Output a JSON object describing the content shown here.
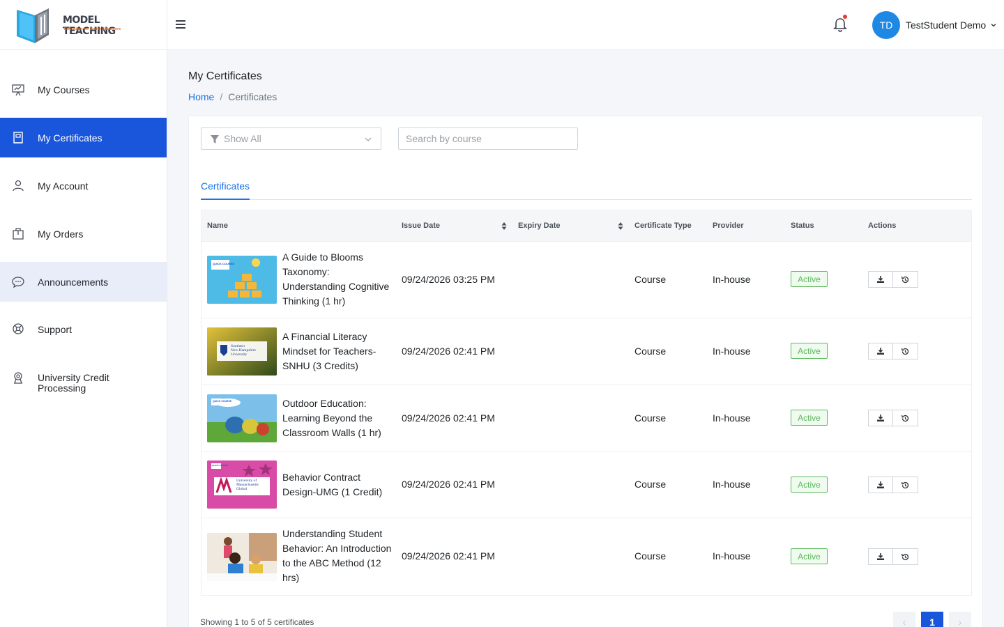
{
  "brand": {
    "name": "MODEL TEACHING",
    "tagline": "Education for Better Educators"
  },
  "user": {
    "initials": "TD",
    "name": "TestStudent Demo"
  },
  "sidebar": {
    "items": [
      {
        "label": "My Courses",
        "icon": "presentation-board-icon"
      },
      {
        "label": "My Certificates",
        "icon": "certificate-book-icon",
        "active": true
      },
      {
        "label": "My Account",
        "icon": "user-icon"
      },
      {
        "label": "My Orders",
        "icon": "order-box-icon"
      },
      {
        "label": "Announcements",
        "icon": "chat-bubble-icon"
      },
      {
        "label": "Support",
        "icon": "lifebuoy-icon"
      },
      {
        "label": "University Credit Processing",
        "label_line1": "University Credit",
        "label_line2": "Processing",
        "icon": "location-badge-icon"
      }
    ]
  },
  "page": {
    "title": "My Certificates"
  },
  "breadcrumb": {
    "home": "Home",
    "separator": "/",
    "current": "Certificates"
  },
  "filters": {
    "show_all": "Show All",
    "search_placeholder": "Search by course"
  },
  "tabs": [
    {
      "label": "Certificates",
      "active": true
    }
  ],
  "table": {
    "headers": {
      "name": "Name",
      "issue_date": "Issue Date",
      "expiry_date": "Expiry Date",
      "certificate_type": "Certificate Type",
      "provider": "Provider",
      "status": "Status",
      "actions": "Actions"
    },
    "rows": [
      {
        "name": "A Guide to Blooms Taxonomy: Understanding Cognitive Thinking (1 hr)",
        "issue_date": "09/24/2026 03:25 PM",
        "expiry_date": "",
        "type": "Course",
        "provider": "In-house",
        "status": "Active"
      },
      {
        "name": "A Financial Literacy Mindset for Teachers-SNHU (3 Credits)",
        "issue_date": "09/24/2026 02:41 PM",
        "expiry_date": "",
        "type": "Course",
        "provider": "In-house",
        "status": "Active"
      },
      {
        "name": "Outdoor Education: Learning Beyond the Classroom Walls (1 hr)",
        "issue_date": "09/24/2026 02:41 PM",
        "expiry_date": "",
        "type": "Course",
        "provider": "In-house",
        "status": "Active"
      },
      {
        "name": "Behavior Contract Design-UMG (1 Credit)",
        "issue_date": "09/24/2026 02:41 PM",
        "expiry_date": "",
        "type": "Course",
        "provider": "In-house",
        "status": "Active"
      },
      {
        "name": "Understanding Student Behavior: An Introduction to the ABC Method (12 hrs)",
        "issue_date": "09/24/2026 02:41 PM",
        "expiry_date": "",
        "type": "Course",
        "provider": "In-house",
        "status": "Active"
      }
    ]
  },
  "thumbnails": {
    "quick_course": "QUICK COURSE",
    "snhu_line1": "Southern",
    "snhu_line2": "New Hampshire",
    "snhu_line3": "University",
    "umg_line1": "University of",
    "umg_line2": "Massachusetts",
    "umg_line3": "Global"
  },
  "pagination": {
    "summary": "Showing 1 to 5 of 5 certificates",
    "prev": "‹",
    "current": "1",
    "next": "›"
  },
  "colors": {
    "primary": "#1a56db",
    "link": "#1a73e8",
    "active_badge": "#5cb85c",
    "avatar": "#1e88e5"
  }
}
